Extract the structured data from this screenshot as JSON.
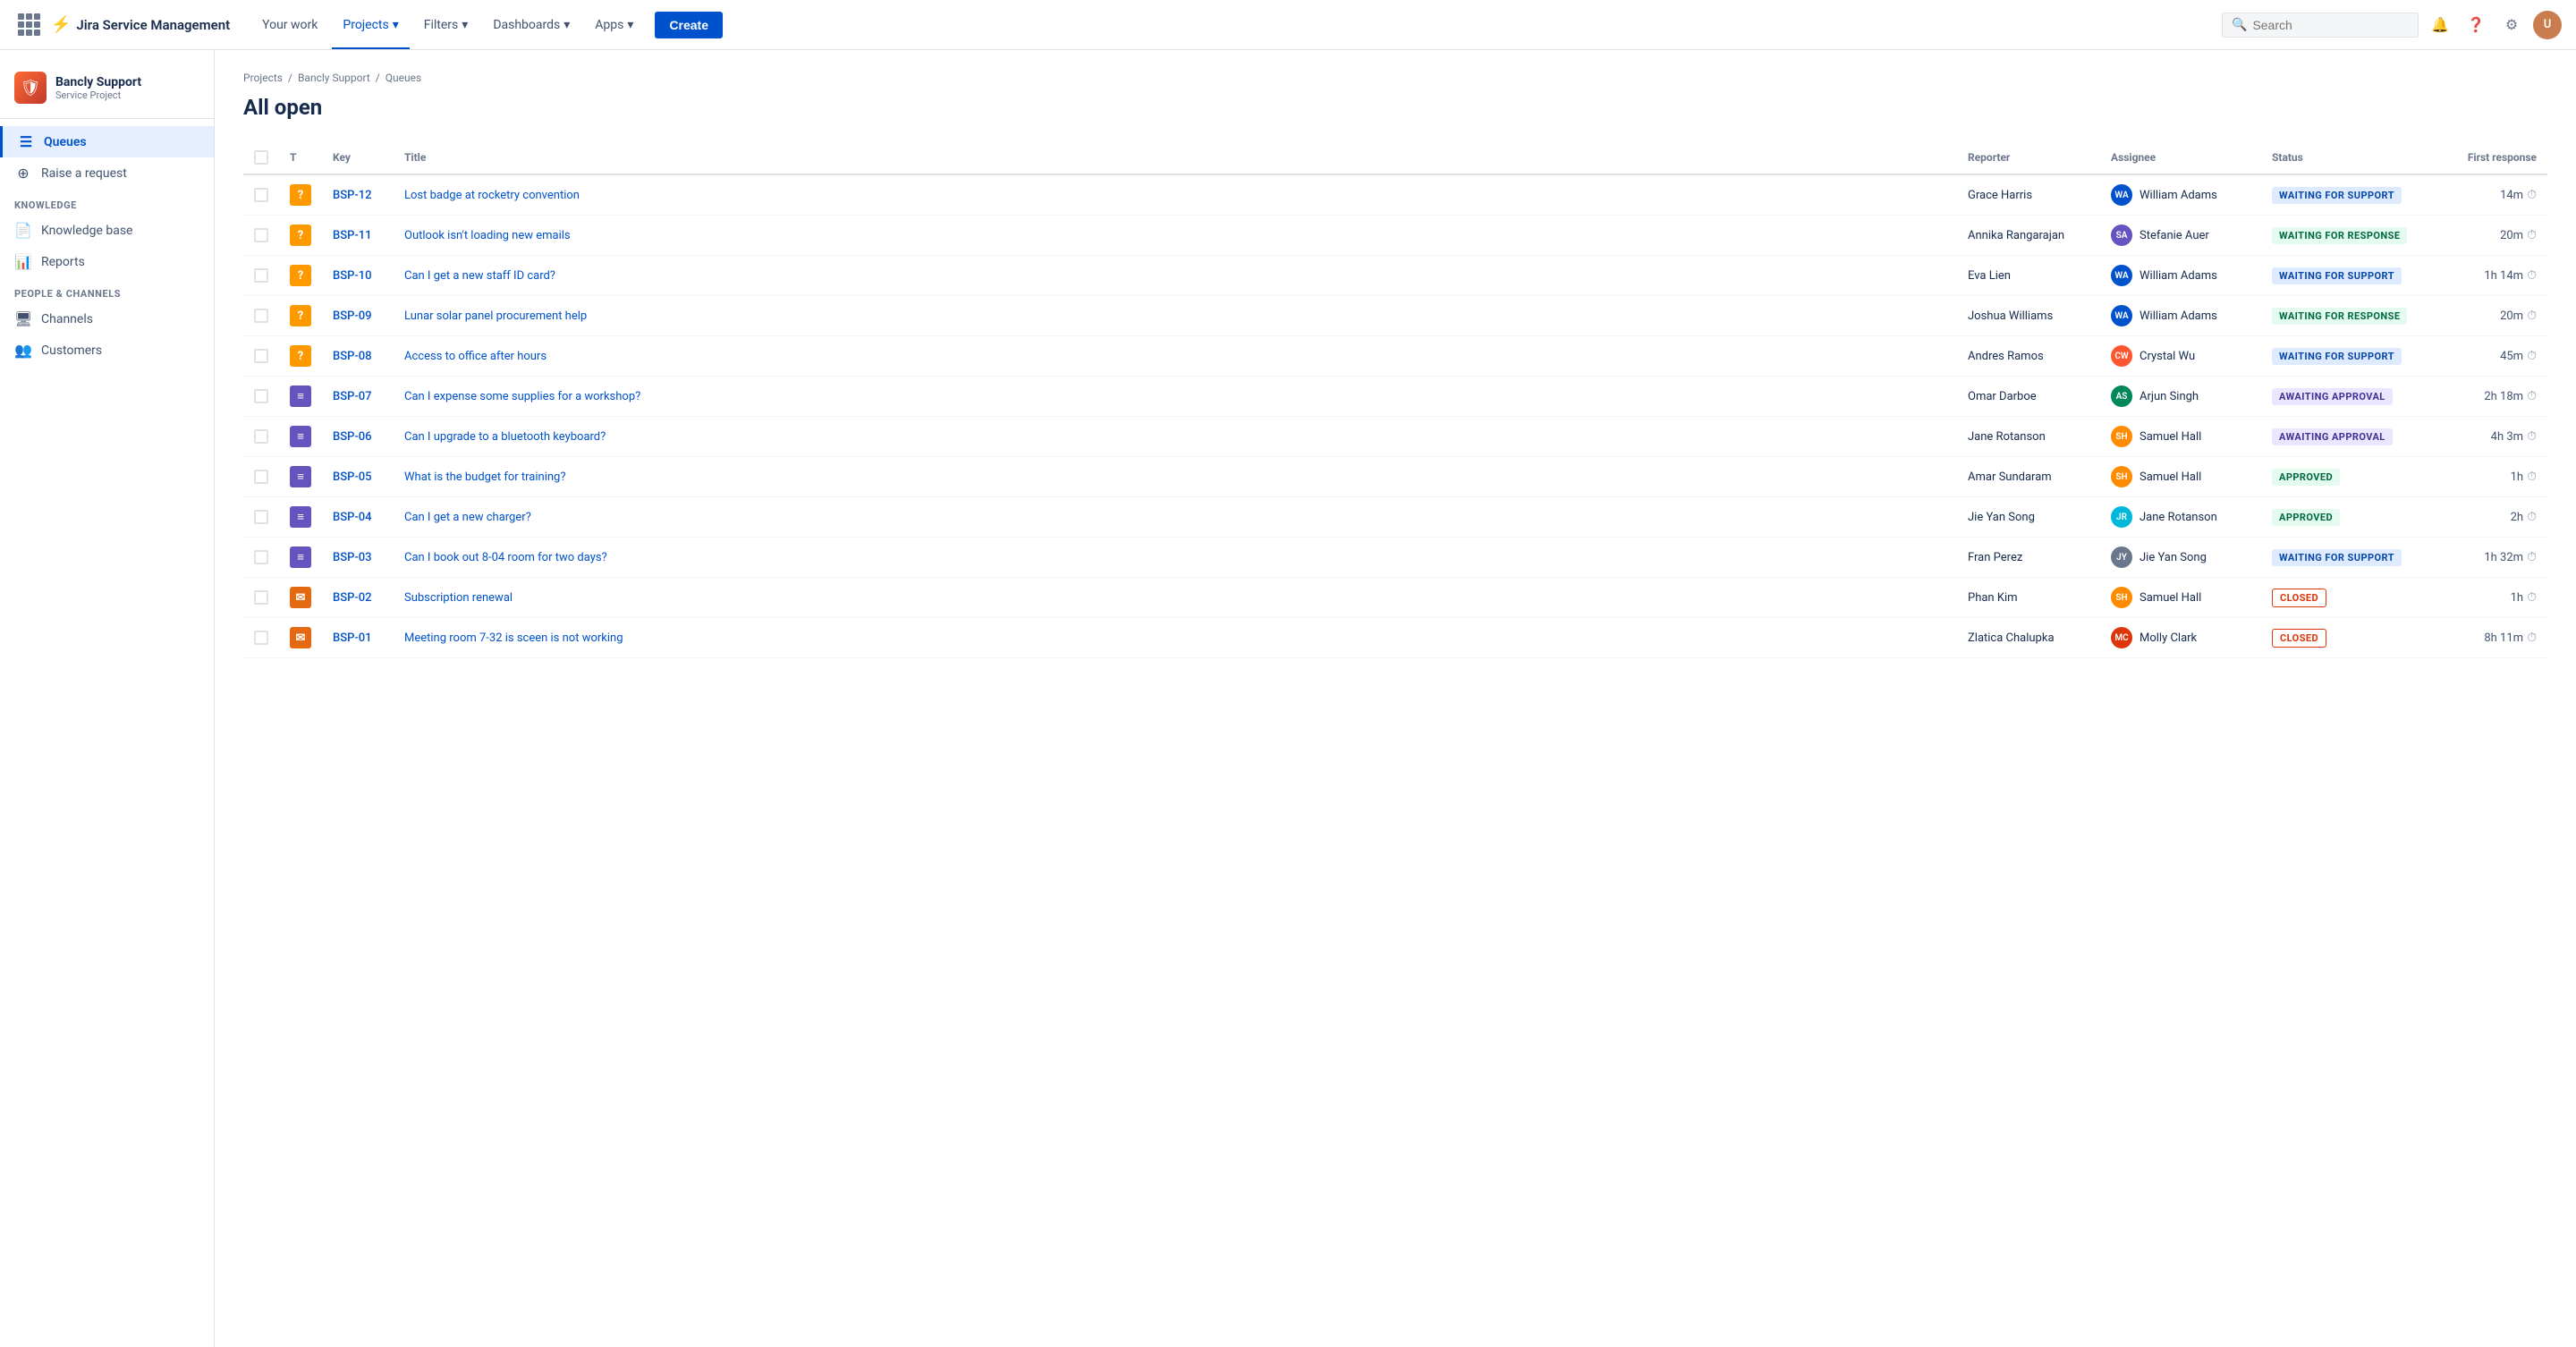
{
  "app": {
    "name": "Jira Service Management"
  },
  "topnav": {
    "your_work": "Your work",
    "projects": "Projects",
    "filters": "Filters",
    "dashboards": "Dashboards",
    "apps": "Apps",
    "create": "Create",
    "search_placeholder": "Search"
  },
  "sidebar": {
    "project_name": "Bancly Support",
    "project_type": "Service Project",
    "queues": "Queues",
    "raise_request": "Raise a request",
    "knowledge_section": "KNOWLEDGE",
    "knowledge_base": "Knowledge base",
    "reports": "Reports",
    "people_section": "PEOPLE & CHANNELS",
    "channels": "Channels",
    "customers": "Customers"
  },
  "breadcrumb": {
    "projects": "Projects",
    "bancly_support": "Bancly Support",
    "queues": "Queues"
  },
  "page": {
    "title": "All open"
  },
  "table": {
    "headers": {
      "t": "T",
      "key": "Key",
      "title": "Title",
      "reporter": "Reporter",
      "assignee": "Assignee",
      "status": "Status",
      "first_response": "First response"
    },
    "rows": [
      {
        "key": "BSP-12",
        "type": "question",
        "title": "Lost badge at rocketry convention",
        "reporter": "Grace Harris",
        "assignee": "William Adams",
        "assignee_initials": "WA",
        "assignee_color": "av-blue",
        "status": "WAITING FOR SUPPORT",
        "status_class": "badge-waiting-support",
        "first_response": "14m"
      },
      {
        "key": "BSP-11",
        "type": "question",
        "title": "Outlook isn't loading new emails",
        "reporter": "Annika Rangarajan",
        "assignee": "Stefanie Auer",
        "assignee_initials": "SA",
        "assignee_color": "av-purple",
        "status": "WAITING FOR RESPONSE",
        "status_class": "badge-waiting-response",
        "first_response": "20m"
      },
      {
        "key": "BSP-10",
        "type": "question",
        "title": "Can I get a new staff ID card?",
        "reporter": "Eva Lien",
        "assignee": "William Adams",
        "assignee_initials": "WA",
        "assignee_color": "av-blue",
        "status": "WAITING FOR SUPPORT",
        "status_class": "badge-waiting-support",
        "first_response": "1h 14m"
      },
      {
        "key": "BSP-09",
        "type": "question",
        "title": "Lunar solar panel procurement help",
        "reporter": "Joshua Williams",
        "assignee": "William Adams",
        "assignee_initials": "WA",
        "assignee_color": "av-blue",
        "status": "WAITING FOR RESPONSE",
        "status_class": "badge-waiting-response",
        "first_response": "20m"
      },
      {
        "key": "BSP-08",
        "type": "question",
        "title": "Access to office after hours",
        "reporter": "Andres Ramos",
        "assignee": "Crystal Wu",
        "assignee_initials": "CW",
        "assignee_color": "av-pink",
        "status": "WAITING FOR SUPPORT",
        "status_class": "badge-waiting-support",
        "first_response": "45m"
      },
      {
        "key": "BSP-07",
        "type": "task",
        "title": "Can I expense some supplies for a workshop?",
        "reporter": "Omar Darboe",
        "assignee": "Arjun Singh",
        "assignee_initials": "AS",
        "assignee_color": "av-green",
        "status": "AWAITING APPROVAL",
        "status_class": "badge-awaiting-approval",
        "first_response": "2h 18m"
      },
      {
        "key": "BSP-06",
        "type": "task",
        "title": "Can I upgrade to a bluetooth keyboard?",
        "reporter": "Jane Rotanson",
        "assignee": "Samuel Hall",
        "assignee_initials": "SH",
        "assignee_color": "av-orange",
        "status": "AWAITING APPROVAL",
        "status_class": "badge-awaiting-approval",
        "first_response": "4h 3m"
      },
      {
        "key": "BSP-05",
        "type": "task",
        "title": "What is the budget for training?",
        "reporter": "Amar Sundaram",
        "assignee": "Samuel Hall",
        "assignee_initials": "SH",
        "assignee_color": "av-orange",
        "status": "APPROVED",
        "status_class": "badge-approved",
        "first_response": "1h"
      },
      {
        "key": "BSP-04",
        "type": "task",
        "title": "Can I get a new charger?",
        "reporter": "Jie Yan Song",
        "assignee": "Jane Rotanson",
        "assignee_initials": "JR",
        "assignee_color": "av-teal",
        "status": "APPROVED",
        "status_class": "badge-approved",
        "first_response": "2h"
      },
      {
        "key": "BSP-03",
        "type": "task",
        "title": "Can I book out 8-04 room for two days?",
        "reporter": "Fran Perez",
        "assignee": "Jie Yan Song",
        "assignee_initials": "JY",
        "assignee_color": "av-grey",
        "status": "WAITING FOR SUPPORT",
        "status_class": "badge-waiting-support",
        "first_response": "1h 32m"
      },
      {
        "key": "BSP-02",
        "type": "email",
        "title": "Subscription renewal",
        "reporter": "Phan Kim",
        "assignee": "Samuel Hall",
        "assignee_initials": "SH",
        "assignee_color": "av-orange",
        "status": "CLOSED",
        "status_class": "badge-closed",
        "first_response": "1h"
      },
      {
        "key": "BSP-01",
        "type": "email",
        "title": "Meeting room 7-32 is sceen is not working",
        "reporter": "Zlatica Chalupka",
        "assignee": "Molly Clark",
        "assignee_initials": "MC",
        "assignee_color": "av-red",
        "status": "CLOSED",
        "status_class": "badge-closed",
        "first_response": "8h 11m"
      }
    ]
  }
}
